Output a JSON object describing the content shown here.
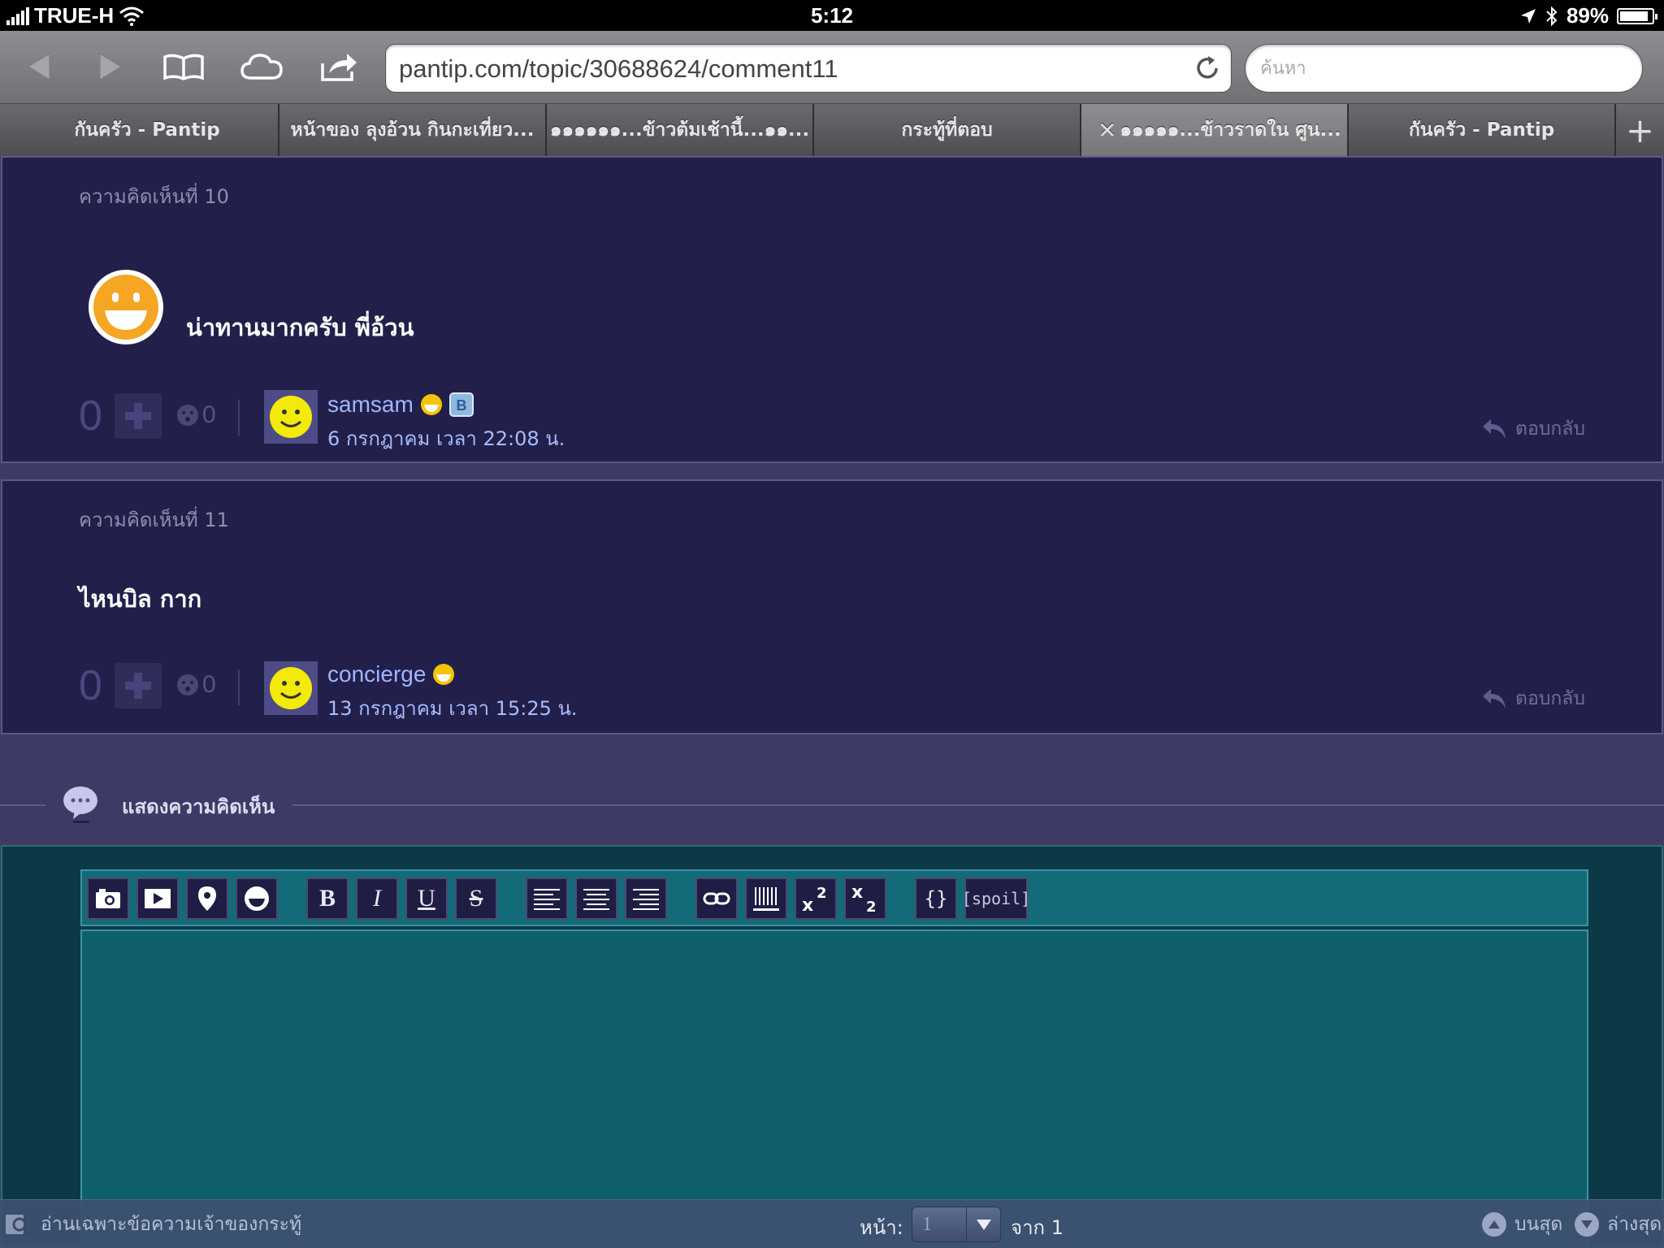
{
  "statusbar": {
    "carrier": "TRUE-H",
    "time": "5:12",
    "battery": "89%",
    "battery_level": 0.89
  },
  "browser": {
    "url": "pantip.com/topic/30688624/comment11",
    "search_placeholder": "ค้นหา"
  },
  "tabs": [
    {
      "label": "กันครัว - Pantip"
    },
    {
      "label": "หน้าของ ลุงอ้วน กินกะเที่ยว..."
    },
    {
      "label": "๑๑๑๑๑๑...ข้าวต้มเช้านี้...๑๑..."
    },
    {
      "label": "กระทู้ที่ตอบ"
    },
    {
      "label": "๑๑๑๑๑...ข้าวราดใน ศูน..."
    },
    {
      "label": "กันครัว - Pantip"
    }
  ],
  "comments": [
    {
      "number": "ความคิดเห็นที่ 10",
      "body": "น่าทานมากครับ พี่อ้วน",
      "votes": "0",
      "emotions": "0",
      "username": "samsam",
      "date": "6 กรกฎาคม เวลา 22:08 น.",
      "reply": "ตอบกลับ"
    },
    {
      "number": "ความคิดเห็นที่ 11",
      "body": "ไหนบิล กาก",
      "votes": "0",
      "emotions": "0",
      "username": "concierge",
      "date": "13 กรกฎาคม เวลา 15:25 น.",
      "reply": "ตอบกลับ"
    }
  ],
  "show_comment": {
    "label": "แสดงความคิดเห็น"
  },
  "editor": {
    "buttons": {
      "bold": "B",
      "italic": "I",
      "underline": "U",
      "strike": "S",
      "code": "{}",
      "spoil": "[spoil]"
    }
  },
  "bottom_bar": {
    "owner_only": "อ่านเฉพาะข้อความเจ้าของกระทู้",
    "page_label": "หน้า:",
    "page_value": "1",
    "of_label": "จาก 1",
    "top": "บนสุด",
    "bottom": "ล่างสุด"
  }
}
